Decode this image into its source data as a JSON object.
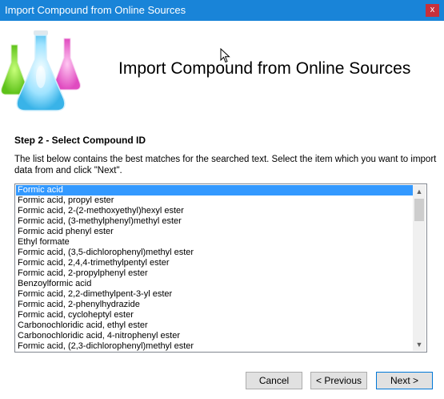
{
  "window": {
    "title": "Import Compound from Online Sources",
    "close_glyph": "x"
  },
  "header": {
    "heading": "Import Compound from Online Sources",
    "logo_icon": "flask-logo-icon"
  },
  "step": {
    "title": "Step 2 - Select Compound ID",
    "description": "The list below contains the best matches for the searched text. Select the item which you want to import data from and click \"Next\"."
  },
  "list": {
    "selected_index": 0,
    "items": [
      "Formic acid",
      "Formic acid, propyl ester",
      "Formic acid, 2-(2-methoxyethyl)hexyl ester",
      "Formic acid, (3-methylphenyl)methyl ester",
      "Formic acid phenyl ester",
      "Ethyl formate",
      "Formic acid, (3,5-dichlorophenyl)methyl ester",
      "Formic acid, 2,4,4-trimethylpentyl ester",
      "Formic acid, 2-propylphenyl ester",
      "Benzoylformic acid",
      "Formic acid, 2,2-dimethylpent-3-yl ester",
      "Formic acid, 2-phenylhydrazide",
      "Formic acid, cycloheptyl ester",
      "Carbonochloridic acid, ethyl ester",
      "Carbonochloridic acid, 4-nitrophenyl ester",
      "Formic acid, (2,3-dichlorophenyl)methyl ester"
    ]
  },
  "buttons": {
    "cancel": "Cancel",
    "previous": "< Previous",
    "next": "Next >"
  },
  "colors": {
    "titlebar": "#1984d8",
    "close": "#c7303a",
    "selection": "#3399ff"
  }
}
